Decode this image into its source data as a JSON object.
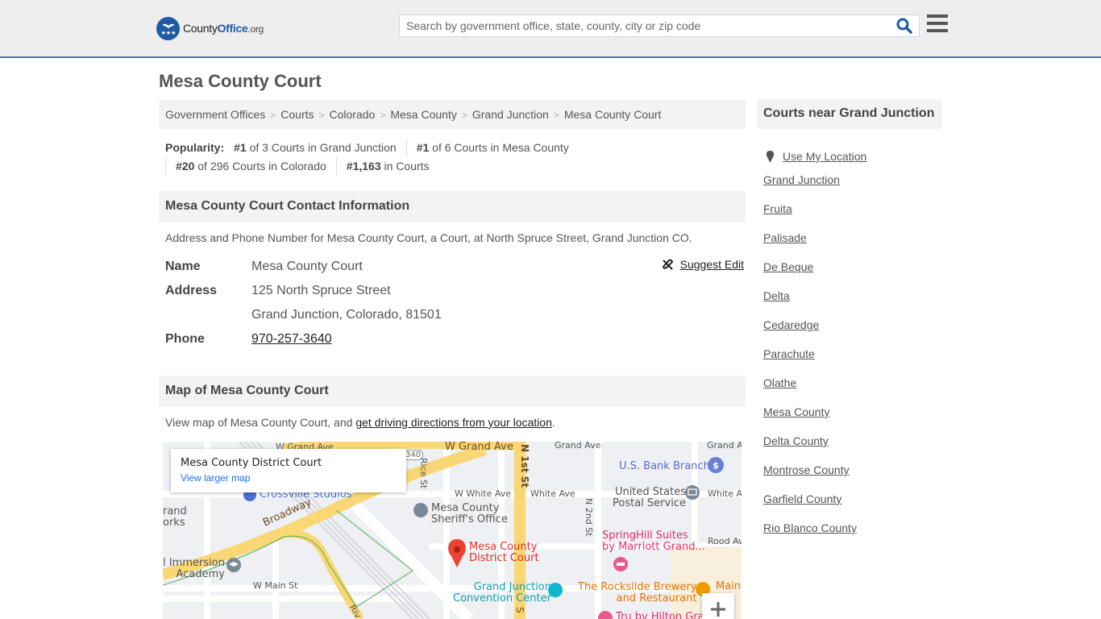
{
  "header": {
    "logo": {
      "county": "County",
      "office": "Office",
      "org": ".org"
    },
    "search": {
      "placeholder": "Search by government office, state, county, city or zip code",
      "value": ""
    },
    "icons": {
      "search": "search-icon",
      "menu": "hamburger-menu-icon"
    }
  },
  "page": {
    "title": "Mesa County Court",
    "breadcrumb": [
      "Government Offices",
      "Courts",
      "Colorado",
      "Mesa County",
      "Grand Junction",
      "Mesa County Court"
    ],
    "popularity": {
      "label": "Popularity:",
      "items": [
        {
          "rank": "#1",
          "text": " of 3 Courts in Grand Junction"
        },
        {
          "rank": "#1",
          "text": " of 6 Courts in Mesa County"
        },
        {
          "rank": "#20",
          "text": " of 296 Courts in Colorado"
        },
        {
          "rank": "#1,163",
          "text": " in Courts"
        }
      ]
    }
  },
  "contact": {
    "heading": "Mesa County Court Contact Information",
    "description": "Address and Phone Number for Mesa County Court, a Court, at North Spruce Street, Grand Junction CO.",
    "suggest_edit": "Suggest Edit",
    "fields": {
      "name_label": "Name",
      "name": "Mesa County Court",
      "address_label": "Address",
      "address_line1": "125 North Spruce Street",
      "address_line2": "Grand Junction, Colorado, 81501",
      "phone_label": "Phone",
      "phone": "970-257-3640"
    }
  },
  "map_section": {
    "heading": "Map of Mesa County Court",
    "desc_prefix": "View map of Mesa County Court, and ",
    "desc_link": "get driving directions from your location",
    "desc_suffix": ".",
    "card_title": "Mesa County District Court",
    "card_link": "View larger map",
    "labels": {
      "w_grand_ave_1": "W Grand Ave",
      "w_grand_ave_2": "W Grand Ave",
      "grand_ave": "Grand Ave",
      "grand_a": "Grand A",
      "rice_st": "Rice St",
      "n_1st_st": "N 1st St",
      "w_white_ave": "W White Ave",
      "white_ave": "White Ave",
      "white_a": "White A",
      "n_2nd_st": "N 2nd St",
      "crossville": "Crossville Studios",
      "broadway": "Broadway",
      "grand_works": "rand\norks",
      "immersion": "l Immersion\nAcademy",
      "w_main_st": "W Main St",
      "sheriff": "Mesa County\nSheriff's Office",
      "district_court": "Mesa County\nDistrict Court",
      "us_bank": "U.S. Bank Branch",
      "usps": "United States\nPostal Service",
      "springhill": "SpringHill Suites\nby Marriott Grand...",
      "rood_ave": "Rood Av",
      "convention": "Grand Junction\nConvention Center",
      "rockslide": "The Rockslide Brewery\nand Restaurant",
      "main": "Main",
      "tru": "Tru by Hilton Gra",
      "riv": "Riv",
      "route_340": "340",
      "s": "S"
    },
    "zoom_in": "+"
  },
  "sidebar": {
    "heading": "Courts near Grand Junction",
    "use_location": "Use My Location",
    "links": [
      "Grand Junction",
      "Fruita",
      "Palisade",
      "De Beque",
      "Delta",
      "Cedaredge",
      "Parachute",
      "Olathe",
      "Mesa County",
      "Delta County",
      "Montrose County",
      "Garfield County",
      "Rio Blanco County"
    ]
  },
  "colors": {
    "brand_blue": "#1f5ba3",
    "header_border": "#3d7ab4",
    "panel_bg": "#f3f3f3",
    "map_pin": "#ea4335"
  }
}
